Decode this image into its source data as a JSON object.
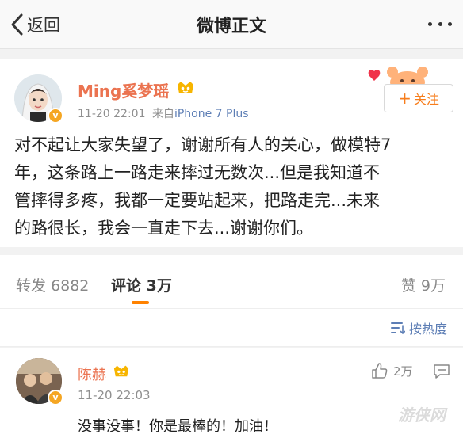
{
  "navbar": {
    "back_label": "返回",
    "title": "微博正文",
    "more_icon": "more-dots-icon"
  },
  "post": {
    "author": "Ming奚梦瑶",
    "time": "11-20 22:01",
    "source_prefix": "来自",
    "device": "iPhone 7 Plus",
    "follow_label": "关注",
    "verified_badge": "v",
    "text_lines": [
      "对不起让大家失望了，谢谢所有人的关心，做模特7",
      "年，这条路上一路走来摔过无数次...但是我知道不",
      "管摔得多疼，我都一定要站起来，把路走完...未来",
      "的路很长，我会一直走下去...谢谢你们。"
    ]
  },
  "stats": {
    "repost": "转发 6882",
    "comment": "评论 3万",
    "like": "赞 9万"
  },
  "sort": {
    "label": "按热度"
  },
  "comments": [
    {
      "name": "陈赫",
      "time": "11-20 22:03",
      "likes": "2万",
      "text": "没事没事！你是最棒的！加油！"
    }
  ],
  "watermark": "游侠网",
  "colors": {
    "accent_orange": "#ff8200",
    "name_orange": "#eb7350",
    "link_blue": "#5d7eb5",
    "verified_gold": "#f5a623"
  }
}
